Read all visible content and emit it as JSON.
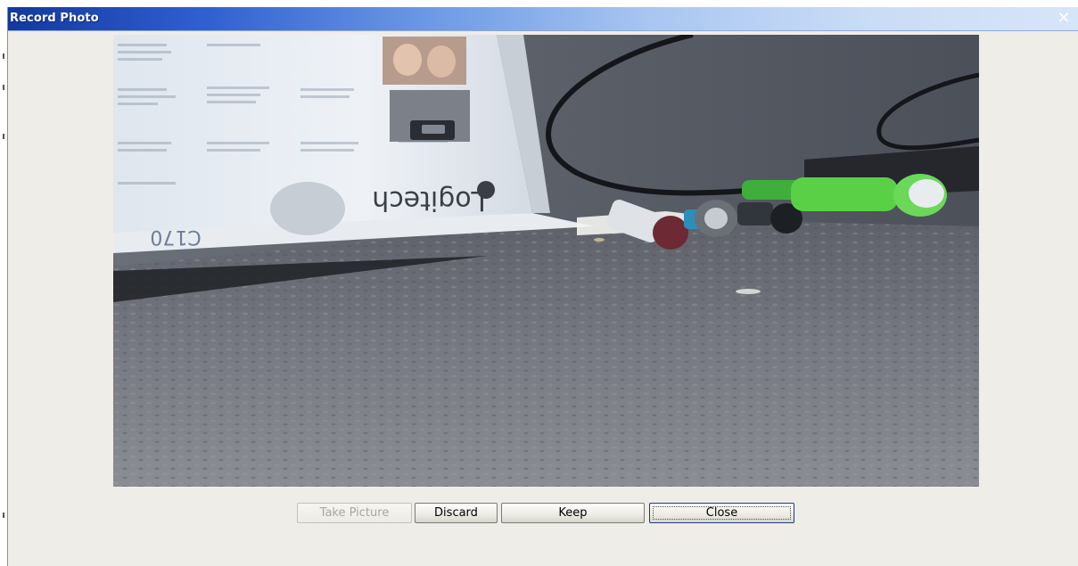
{
  "window": {
    "title": "Record Photo",
    "close_icon": "close-icon"
  },
  "preview": {
    "box_brand_text": "Logitech",
    "box_model_fragment": "C170"
  },
  "buttons": {
    "take_picture": "Take Picture",
    "discard": "Discard",
    "keep": "Keep",
    "close": "Close"
  },
  "states": {
    "take_picture_enabled": false,
    "focused_button": "close"
  },
  "colors": {
    "title_bar_start": "#13389f",
    "title_bar_end": "#d7e5f8",
    "window_background": "#efede7"
  }
}
